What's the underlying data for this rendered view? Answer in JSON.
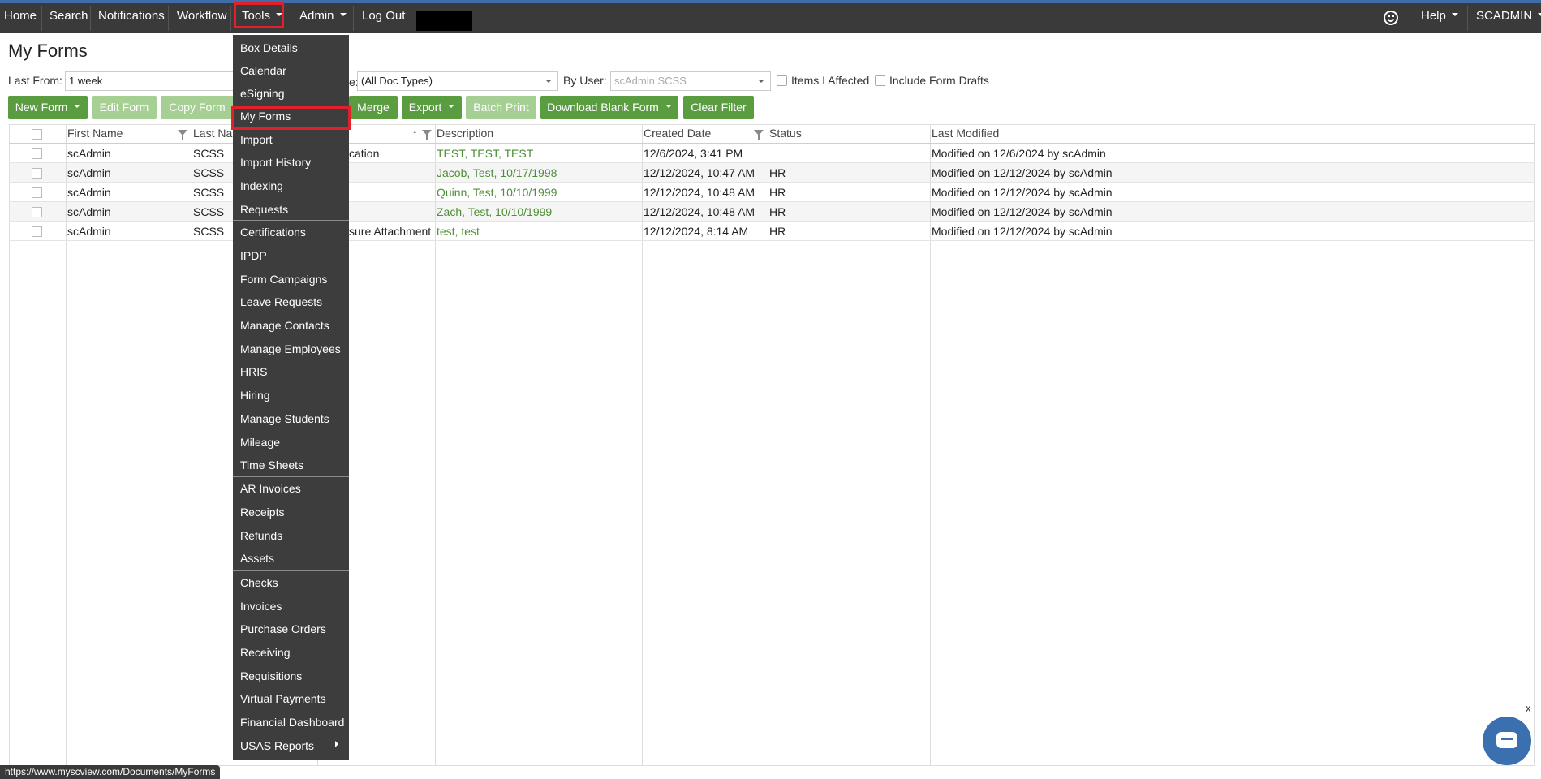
{
  "nav": {
    "home": "Home",
    "search": "Search",
    "notifications": "Notifications",
    "workflow": "Workflow",
    "tools": "Tools",
    "admin": "Admin",
    "logout": "Log Out",
    "help": "Help",
    "user": "SCADMIN"
  },
  "page": {
    "title": "My Forms"
  },
  "filters": {
    "last_from_label": "Last From:",
    "last_from_value": "1 week",
    "doc_type_label_fragment": "e:",
    "doc_type_value": "(All Doc Types)",
    "by_user_label": "By User:",
    "by_user_value": "scAdmin SCSS",
    "items_affected_label": "Items I Affected",
    "include_drafts_label": "Include Form Drafts"
  },
  "toolbar": {
    "new_form": "New Form",
    "edit_form": "Edit Form",
    "copy_form": "Copy Form",
    "merge": "Merge",
    "export": "Export",
    "batch_print": "Batch Print",
    "download_blank": "Download Blank Form",
    "clear_filter": "Clear Filter"
  },
  "table": {
    "headers": {
      "first_name": "First Name",
      "last_name": "Last Na",
      "description": "Description",
      "created": "Created Date",
      "status": "Status",
      "last_modified": "Last Modified"
    },
    "rows": [
      {
        "first": "scAdmin",
        "last": "SCSS",
        "doc": "cation",
        "desc": "TEST, TEST, TEST",
        "created": "12/6/2024, 3:41 PM",
        "status": "",
        "modified": "Modified on 12/6/2024 by scAdmin"
      },
      {
        "first": "scAdmin",
        "last": "SCSS",
        "doc": "",
        "desc": "Jacob, Test, 10/17/1998",
        "created": "12/12/2024, 10:47 AM",
        "status": "HR",
        "modified": "Modified on 12/12/2024 by scAdmin"
      },
      {
        "first": "scAdmin",
        "last": "SCSS",
        "doc": "",
        "desc": "Quinn, Test, 10/10/1999",
        "created": "12/12/2024, 10:48 AM",
        "status": "HR",
        "modified": "Modified on 12/12/2024 by scAdmin"
      },
      {
        "first": "scAdmin",
        "last": "SCSS",
        "doc": "",
        "desc": "Zach, Test, 10/10/1999",
        "created": "12/12/2024, 10:48 AM",
        "status": "HR",
        "modified": "Modified on 12/12/2024 by scAdmin"
      },
      {
        "first": "scAdmin",
        "last": "SCSS",
        "doc": "sure Attachment",
        "desc": "test, test",
        "created": "12/12/2024, 8:14 AM",
        "status": "HR",
        "modified": "Modified on 12/12/2024 by scAdmin"
      }
    ]
  },
  "tools_menu": {
    "items": [
      "Box Details",
      "Calendar",
      "eSigning",
      "My Forms",
      "Import",
      "Import History",
      "Indexing",
      "Requests",
      "Certifications",
      "IPDP",
      "Form Campaigns",
      "Leave Requests",
      "Manage Contacts",
      "Manage Employees",
      "HRIS",
      "Hiring",
      "Manage Students",
      "Mileage",
      "Time Sheets",
      "AR Invoices",
      "Receipts",
      "Refunds",
      "Assets",
      "Checks",
      "Invoices",
      "Purchase Orders",
      "Receiving",
      "Requisitions",
      "Virtual Payments",
      "Financial Dashboard",
      "USAS Reports"
    ]
  },
  "status_url": "https://www.myscview.com/Documents/MyForms",
  "chat": {
    "close": "x"
  },
  "colors": {
    "nav_bg": "#3a3a3a",
    "button_green": "#5a9c40",
    "highlight_red": "#e0202a",
    "link_green": "#4d8f35"
  }
}
